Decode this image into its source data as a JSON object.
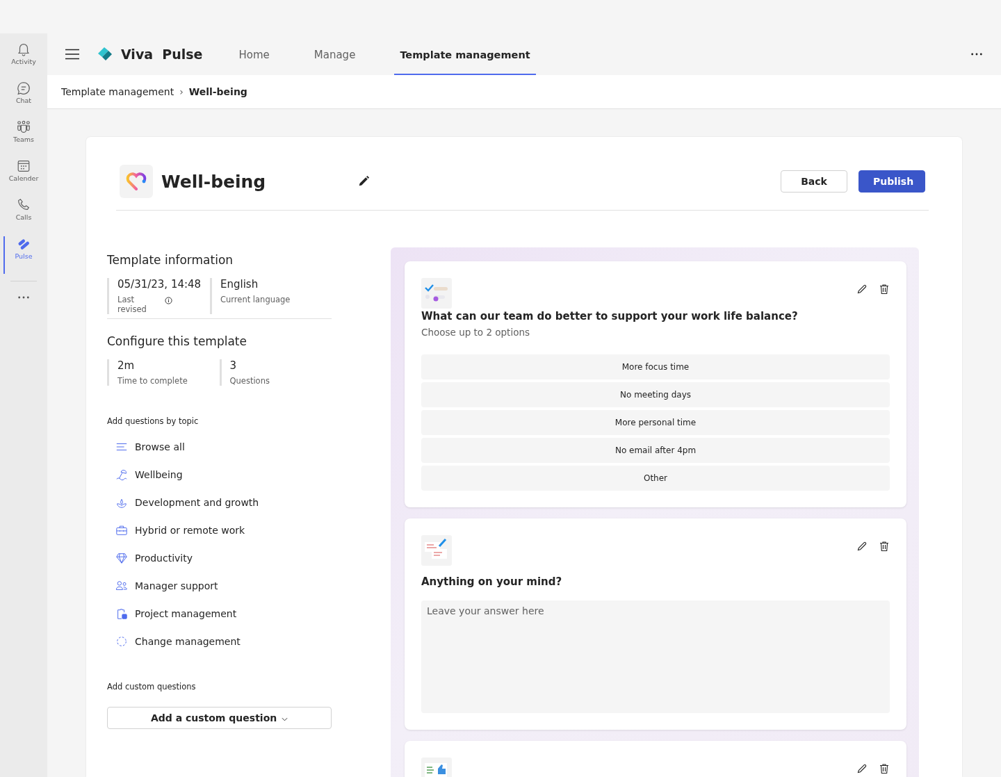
{
  "rail": [
    {
      "label": "Activity",
      "selected": false
    },
    {
      "label": "Chat",
      "selected": false
    },
    {
      "label": "Teams",
      "selected": false
    },
    {
      "label": "Calender",
      "selected": false
    },
    {
      "label": "Calls",
      "selected": false
    },
    {
      "label": "Pulse",
      "selected": true
    }
  ],
  "app": {
    "name_1": "Viva",
    "name_2": "Pulse"
  },
  "tabs": [
    {
      "label": "Home",
      "selected": false
    },
    {
      "label": "Manage",
      "selected": false
    },
    {
      "label": "Template management",
      "selected": true
    }
  ],
  "breadcrumb": {
    "parent": "Template management",
    "separator": "›",
    "current": "Well-being"
  },
  "template": {
    "title": "Well-being",
    "buttons": {
      "back": "Back",
      "publish": "Publish"
    }
  },
  "info": {
    "heading": "Template information",
    "stats": [
      {
        "value": "05/31/23, 14:48",
        "label": "Last revised",
        "info": true
      },
      {
        "value": "English",
        "label": "Current language",
        "info": false
      }
    ]
  },
  "configure": {
    "heading": "Configure this template",
    "stats": [
      {
        "value": "2m",
        "label": "Time to complete"
      },
      {
        "value": "3",
        "label": "Questions"
      }
    ]
  },
  "topics": {
    "heading": "Add questions by topic",
    "items": [
      "Browse all",
      "Wellbeing",
      "Development and growth",
      "Hybrid or remote work",
      "Productivity",
      "Manager support",
      "Project management",
      "Change management"
    ]
  },
  "custom": {
    "heading": "Add custom questions",
    "button": "Add a custom question"
  },
  "questions": [
    {
      "kind": "choice",
      "title": "What can our team do better to support your work life balance?",
      "hint": "Choose up to 2 options",
      "options": [
        "More focus time",
        "No meeting days",
        "More personal time",
        "No email after 4pm",
        "Other"
      ]
    },
    {
      "kind": "text",
      "title": "Anything on your mind?",
      "placeholder": "Leave your answer here"
    },
    {
      "kind": "rating"
    }
  ]
}
